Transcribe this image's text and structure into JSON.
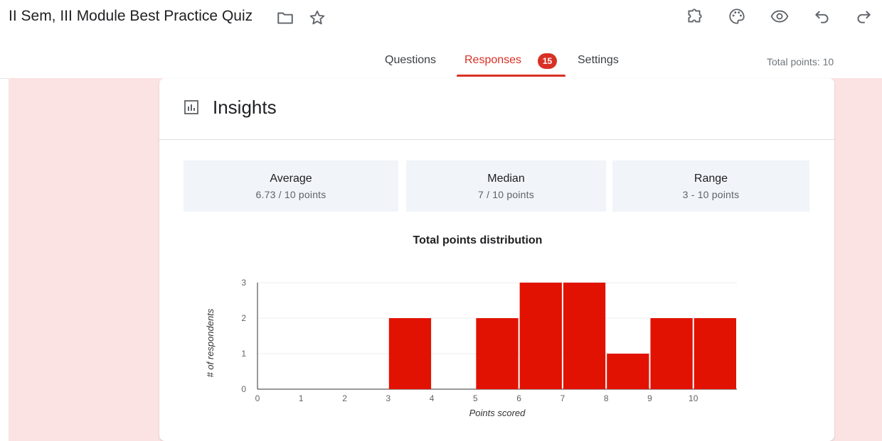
{
  "header": {
    "title": "II Sem, III Module Best Practice Quiz",
    "icons": [
      "folder-icon",
      "star-icon",
      "addon-icon",
      "palette-icon",
      "preview-eye-icon",
      "undo-icon",
      "redo-icon"
    ]
  },
  "tabs": [
    {
      "label": "Questions",
      "active": false
    },
    {
      "label": "Responses",
      "active": true,
      "badge": "15"
    },
    {
      "label": "Settings",
      "active": false
    }
  ],
  "total_points": "Total points: 10",
  "insights": {
    "title": "Insights",
    "icon": "bar-chart-icon",
    "stats": [
      {
        "label": "Average",
        "value": "6.73 / 10 points"
      },
      {
        "label": "Median",
        "value": "7 / 10 points"
      },
      {
        "label": "Range",
        "value": "3 - 10 points"
      }
    ]
  },
  "colors": {
    "accent": "#d93025",
    "bar": "#e11202",
    "background_band": "#fbe3e3"
  },
  "chart_data": {
    "type": "bar",
    "title": "Total points distribution",
    "xlabel": "Points scored",
    "ylabel": "# of respondents",
    "categories": [
      "0",
      "1",
      "2",
      "3",
      "4",
      "5",
      "6",
      "7",
      "8",
      "9",
      "10"
    ],
    "values": [
      0,
      0,
      0,
      2,
      0,
      2,
      3,
      3,
      1,
      2,
      2
    ],
    "yticks": [
      "0",
      "1",
      "2",
      "3"
    ],
    "ylim": [
      0,
      3
    ],
    "grid": true,
    "legend": "none"
  }
}
